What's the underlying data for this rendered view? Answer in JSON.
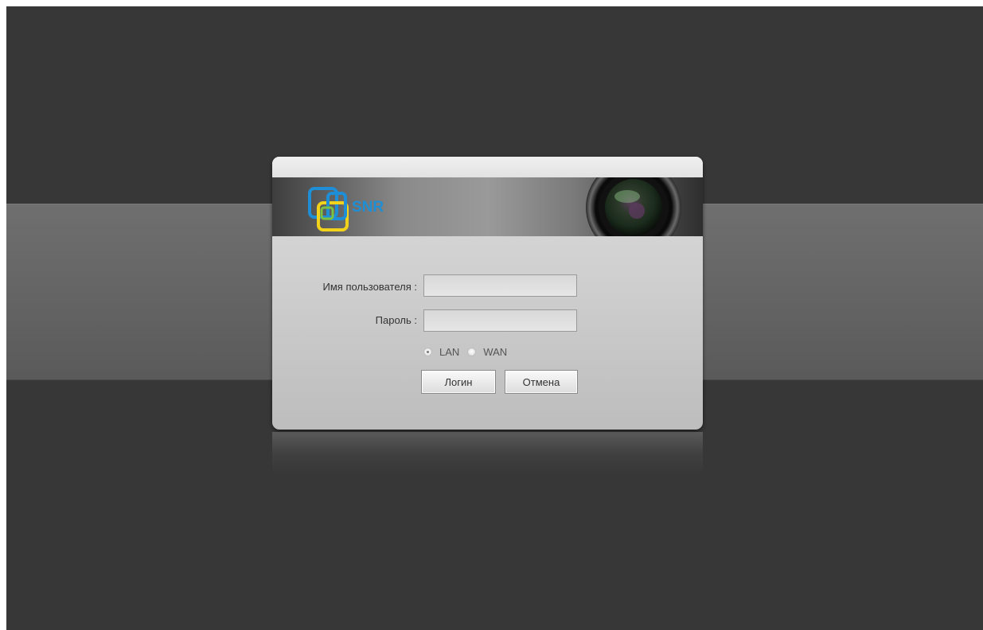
{
  "brand": {
    "logo_text": "SNR"
  },
  "login": {
    "username_label": "Имя пользователя :",
    "username_value": "",
    "password_label": "Пароль :",
    "password_value": "",
    "network_options": [
      {
        "label": "LAN",
        "selected": true
      },
      {
        "label": "WAN",
        "selected": false
      }
    ],
    "login_button": "Логин",
    "cancel_button": "Отмена"
  },
  "colors": {
    "background": "#373737",
    "logo_blue": "#1e8fd6",
    "logo_yellow": "#f3d21c",
    "logo_green": "#7cc242"
  }
}
